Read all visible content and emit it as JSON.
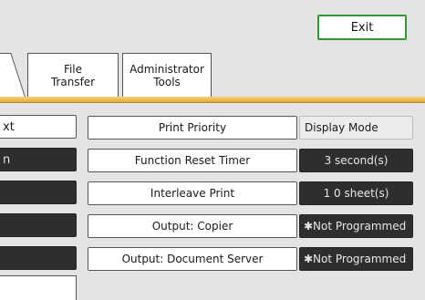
{
  "toolbar": {
    "exit_label": "Exit"
  },
  "tabs": [
    {
      "label_lines": [
        "File",
        "Transfer"
      ]
    },
    {
      "label_lines": [
        "Administrator",
        "Tools"
      ]
    }
  ],
  "left_column": [
    {
      "label": "xt"
    },
    {
      "label": "n"
    }
  ],
  "settings": [
    {
      "label": "Print Priority",
      "value": "Display Mode"
    },
    {
      "label": "Function Reset Timer",
      "value": "3  second(s)"
    },
    {
      "label": "Interleave Print",
      "value": "1 0  sheet(s)"
    },
    {
      "label": "Output: Copier",
      "value": "✱Not Programmed"
    },
    {
      "label": "Output: Document Server",
      "value": "✱Not Programmed"
    }
  ],
  "colors": {
    "exit_border": "#2f9a2f",
    "divider": "#e0a93a",
    "dark_value_bg": "#2e2e2e"
  }
}
